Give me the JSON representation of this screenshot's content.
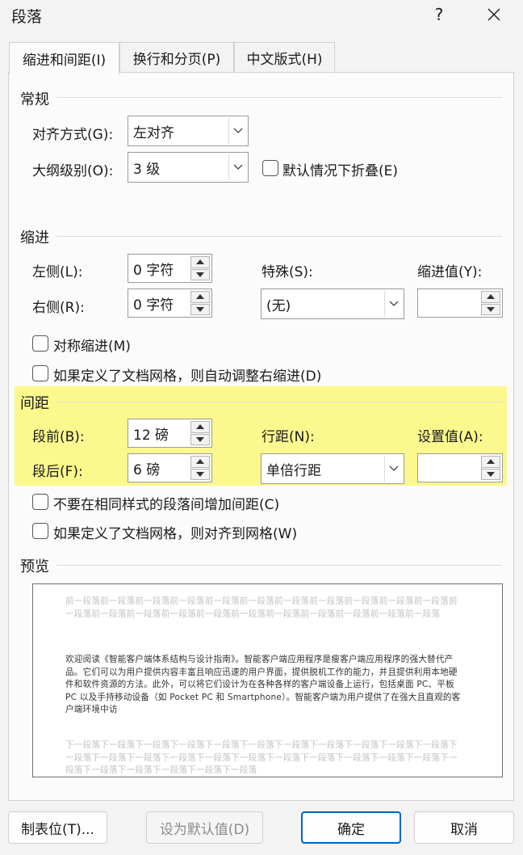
{
  "window": {
    "title": "段落",
    "help": "?",
    "close": "✕"
  },
  "tabs": [
    {
      "label": "缩进和间距(I)",
      "active": true
    },
    {
      "label": "换行和分页(P)",
      "active": false
    },
    {
      "label": "中文版式(H)",
      "active": false
    }
  ],
  "general": {
    "heading": "常规",
    "alignment_label": "对齐方式(G):",
    "alignment_value": "左对齐",
    "outline_label": "大纲级别(O):",
    "outline_value": "3 级",
    "collapse_label": "默认情况下折叠(E)"
  },
  "indent": {
    "heading": "缩进",
    "left_label": "左侧(L):",
    "left_value": "0 字符",
    "right_label": "右侧(R):",
    "right_value": "0 字符",
    "special_label": "特殊(S):",
    "special_value": "(无)",
    "by_label": "缩进值(Y):",
    "by_value": "",
    "mirror_label": "对称缩进(M)",
    "auto_adjust_label": "如果定义了文档网格，则自动调整右缩进(D)"
  },
  "spacing": {
    "heading": "间距",
    "before_label": "段前(B):",
    "before_value": "12 磅",
    "after_label": "段后(F):",
    "after_value": "6 磅",
    "line_label": "行距(N):",
    "line_value": "单倍行距",
    "at_label": "设置值(A):",
    "at_value": "",
    "no_space_label": "不要在相同样式的段落间增加间距(C)",
    "snap_grid_label": "如果定义了文档网格，则对齐到网格(W)",
    "highlight_color": "#fbf88e"
  },
  "preview": {
    "heading": "预览",
    "prev_text": "前一段落前一段落前一段落前一段落前一段落前一段落前一段落前一段落前一段落前一段落前一段落前一段落前一段落前一段落前一段落前一段落前一段落前一段落前一段落前一段落前一段落前一段落",
    "body_text": "欢迎阅读《智能客户端体系结构与设计指南》。智能客户端应用程序是瘦客户端应用程序的强大替代产品。它们可以为用户提供内容丰富且响应迅速的用户界面，提供脱机工作的能力，并且提供利用本地硬件和软件资源的方法。此外，可以将它们设计为在各种各样的客户端设备上运行，包括桌面 PC、平板 PC 以及手持移动设备（如 Pocket PC 和 Smartphone）。智能客户端为用户提供了在强大且直观的客户端环境中访",
    "next_text": "下一段落下一段落下一段落下一段落下一段落下一段落下一段落下一段落下一段落下一段落下一段落下一段落下一段落下一段落下一段落下一段落下一段落下一段落下一段落下一段落下一段落下一段落下一段落下一段落下一段落下一段落下一段落下一段落"
  },
  "buttons": {
    "tabs": "制表位(T)...",
    "set_default": "设为默认值(D)",
    "ok": "确定",
    "cancel": "取消"
  },
  "colors": {
    "ok_border": "#0067c0",
    "background": "#f3f3f3"
  }
}
